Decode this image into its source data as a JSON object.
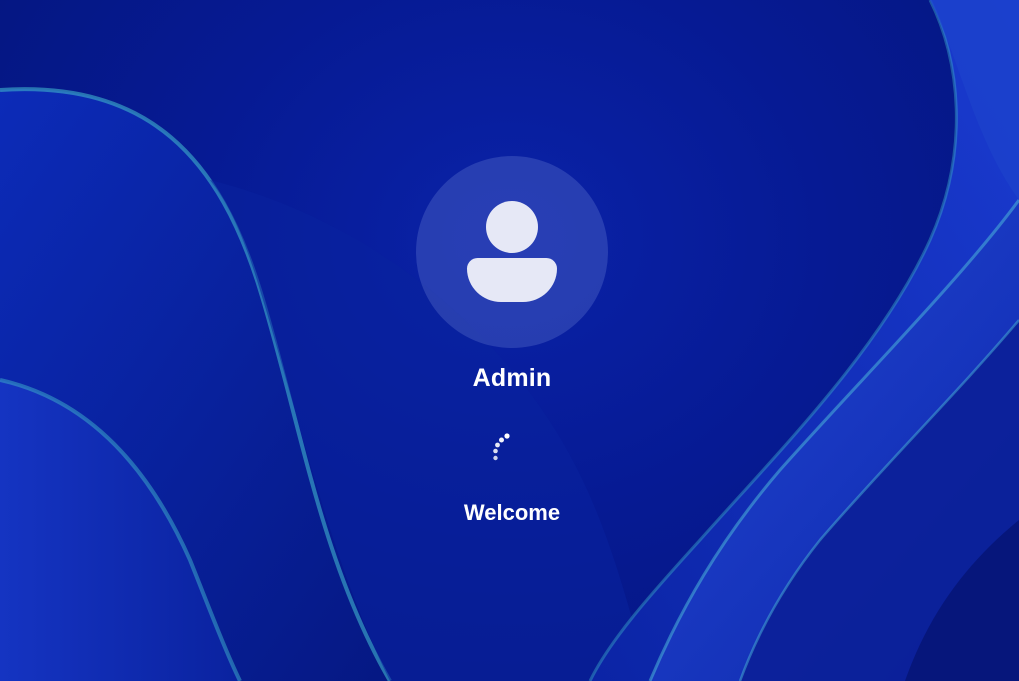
{
  "login": {
    "username": "Admin",
    "status": "Welcome"
  },
  "icons": {
    "avatar": "user-avatar-icon",
    "spinner": "loading-spinner-icon"
  },
  "colors": {
    "background": "#061a8f",
    "ribbon": "#1f3fc6",
    "ribbon_edge": "#3aa6c8",
    "text": "#ffffff",
    "avatar_glyph": "#e6e8f6"
  }
}
